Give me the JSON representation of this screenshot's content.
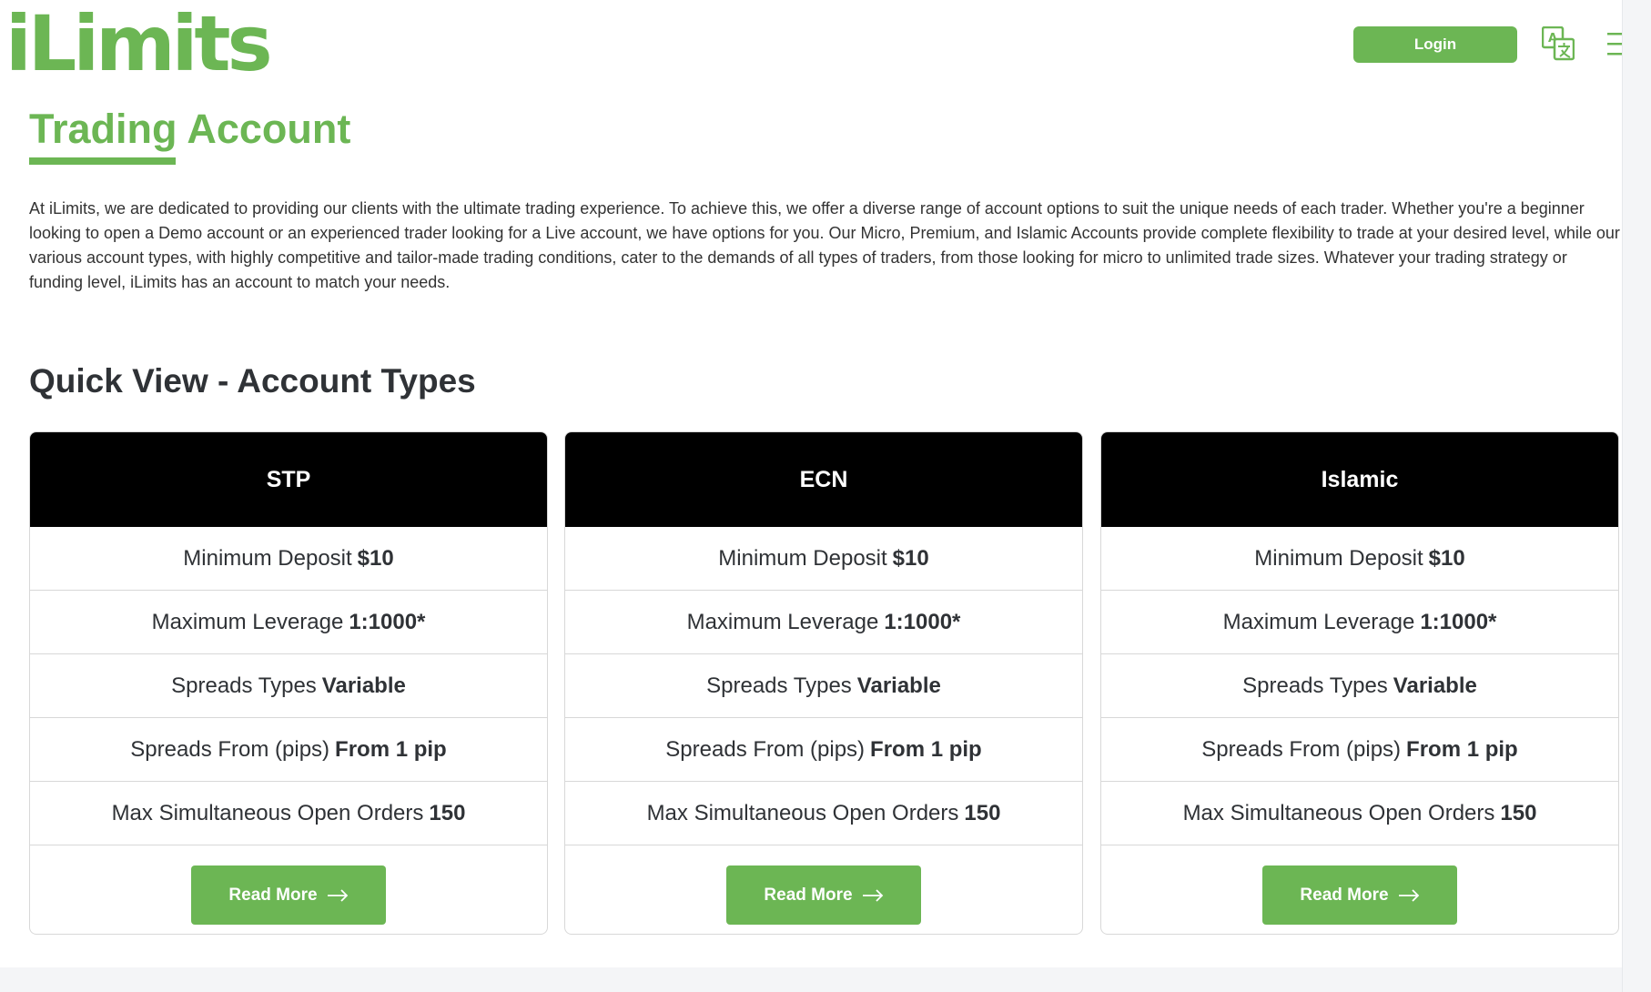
{
  "header": {
    "logo_text": "iLimits",
    "login_label": "Login",
    "translate_icon": "translate-icon",
    "menu_icon": "hamburger-menu-icon"
  },
  "page": {
    "title": "Trading Account",
    "intro": "At iLimits, we are dedicated to providing our clients with the ultimate trading experience. To achieve this, we offer a diverse range of account options to suit the unique needs of each trader. Whether you're a beginner looking to open a Demo account or an experienced trader looking for a Live account, we have options for you. Our Micro, Premium, and Islamic Accounts provide complete flexibility to trade at your desired level, while our various account types, with highly competitive and tailor-made trading conditions, cater to the demands of all types of traders, from those looking for micro to unlimited trade sizes. Whatever your trading strategy or funding level, iLimits has an account to match your needs.",
    "section_title": "Quick View - Account Types"
  },
  "cards": [
    {
      "name": "STP",
      "rows": [
        {
          "label": "Minimum Deposit",
          "value": "$10"
        },
        {
          "label": "Maximum Leverage",
          "value": "1:1000*"
        },
        {
          "label": "Spreads Types",
          "value": "Variable"
        },
        {
          "label": "Spreads From (pips)",
          "value": "From 1 pip"
        },
        {
          "label": "Max Simultaneous Open Orders",
          "value": "150"
        }
      ],
      "button": "Read More"
    },
    {
      "name": "ECN",
      "rows": [
        {
          "label": "Minimum Deposit",
          "value": "$10"
        },
        {
          "label": "Maximum Leverage",
          "value": "1:1000*"
        },
        {
          "label": "Spreads Types",
          "value": "Variable"
        },
        {
          "label": "Spreads From (pips)",
          "value": "From 1 pip"
        },
        {
          "label": "Max Simultaneous Open Orders",
          "value": "150"
        }
      ],
      "button": "Read More"
    },
    {
      "name": "Islamic",
      "rows": [
        {
          "label": "Minimum Deposit",
          "value": "$10"
        },
        {
          "label": "Maximum Leverage",
          "value": "1:1000*"
        },
        {
          "label": "Spreads Types",
          "value": "Variable"
        },
        {
          "label": "Spreads From (pips)",
          "value": "From 1 pip"
        },
        {
          "label": "Max Simultaneous Open Orders",
          "value": "150"
        }
      ],
      "button": "Read More"
    }
  ],
  "colors": {
    "brand_green": "#6cb654",
    "card_header_bg": "#000000",
    "text": "#2f3236"
  }
}
